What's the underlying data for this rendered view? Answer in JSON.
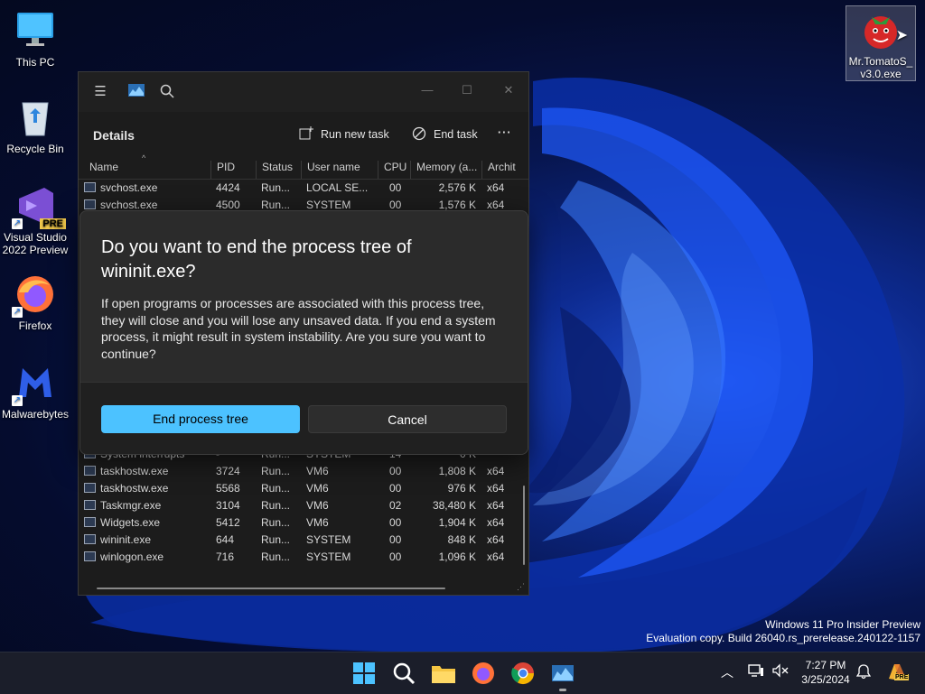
{
  "desktop": {
    "icons": [
      {
        "label": "This PC"
      },
      {
        "label": "Recycle Bin"
      },
      {
        "label": "Visual Studio 2022 Preview",
        "badge": "PRE"
      },
      {
        "label": "Firefox"
      },
      {
        "label": "Malwarebytes"
      },
      {
        "label": "Mr.TomatoS_v3.0.exe",
        "label_line1": "Mr.TomatoS_",
        "label_line2": "v3.0.exe"
      }
    ]
  },
  "task_manager": {
    "heading": "Details",
    "toolbar": {
      "run_new_task": "Run new task",
      "end_task": "End task",
      "more": "···"
    },
    "window_controls": {
      "minimize": "—",
      "maximize": "☐",
      "close": "✕"
    },
    "columns": [
      "Name",
      "PID",
      "Status",
      "User name",
      "CPU",
      "Memory (a...",
      "Archit"
    ],
    "rows_top": [
      {
        "name": "svchost.exe",
        "pid": "4424",
        "status": "Run...",
        "user": "LOCAL SE...",
        "cpu": "00",
        "mem": "2,576 K",
        "arch": "x64"
      },
      {
        "name": "svchost.exe",
        "pid": "4500",
        "status": "Run...",
        "user": "SYSTEM",
        "cpu": "00",
        "mem": "1,576 K",
        "arch": "x64"
      }
    ],
    "rows_bottom": [
      {
        "name": "System interrupts",
        "pid": "-",
        "status": "Run...",
        "user": "SYSTEM",
        "cpu": "14",
        "mem": "0 K",
        "arch": ""
      },
      {
        "name": "taskhostw.exe",
        "pid": "3724",
        "status": "Run...",
        "user": "VM6",
        "cpu": "00",
        "mem": "1,808 K",
        "arch": "x64"
      },
      {
        "name": "taskhostw.exe",
        "pid": "5568",
        "status": "Run...",
        "user": "VM6",
        "cpu": "00",
        "mem": "976 K",
        "arch": "x64"
      },
      {
        "name": "Taskmgr.exe",
        "pid": "3104",
        "status": "Run...",
        "user": "VM6",
        "cpu": "02",
        "mem": "38,480 K",
        "arch": "x64"
      },
      {
        "name": "Widgets.exe",
        "pid": "5412",
        "status": "Run...",
        "user": "VM6",
        "cpu": "00",
        "mem": "1,904 K",
        "arch": "x64"
      },
      {
        "name": "wininit.exe",
        "pid": "644",
        "status": "Run...",
        "user": "SYSTEM",
        "cpu": "00",
        "mem": "848 K",
        "arch": "x64"
      },
      {
        "name": "winlogon.exe",
        "pid": "716",
        "status": "Run...",
        "user": "SYSTEM",
        "cpu": "00",
        "mem": "1,096 K",
        "arch": "x64"
      }
    ]
  },
  "dialog": {
    "title": "Do you want to end the process tree of wininit.exe?",
    "body": "If open programs or processes are associated with this process tree, they will close and you will lose any unsaved data. If you end a system process, it might result in system instability. Are you sure you want to continue?",
    "primary_button": "End process tree",
    "secondary_button": "Cancel"
  },
  "watermark": {
    "line1": "Windows 11 Pro Insider Preview",
    "line2": "Evaluation copy. Build 26040.rs_prerelease.240122-1157"
  },
  "taskbar": {
    "time": "7:27 PM",
    "date": "3/25/2024",
    "tray_badge": "PRE"
  },
  "colors": {
    "accent": "#4cc2ff",
    "taskbar": "#1b1e2a"
  }
}
